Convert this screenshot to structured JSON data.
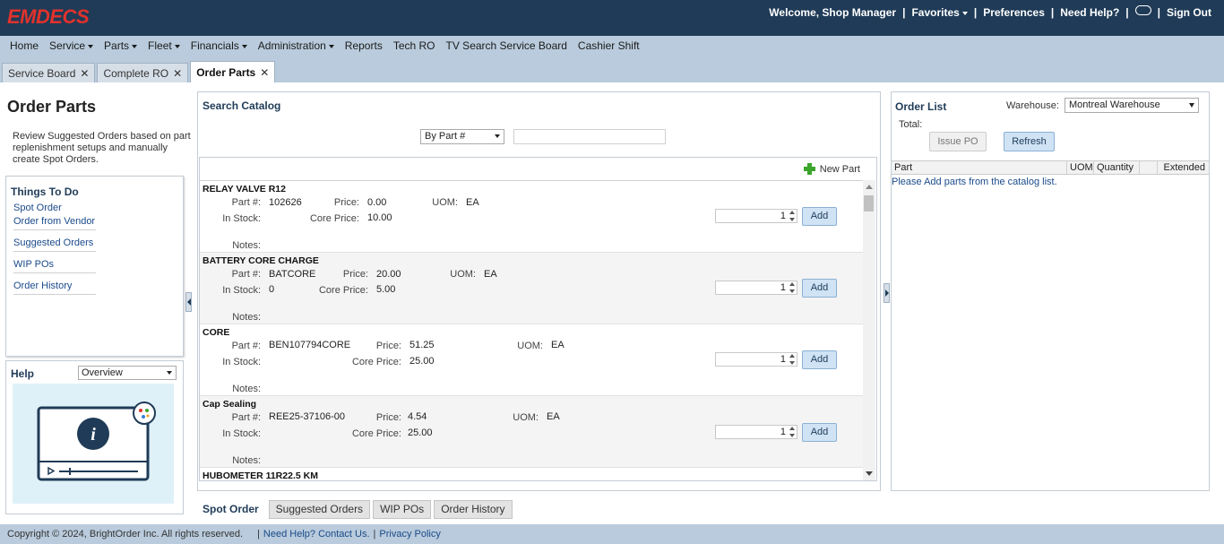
{
  "header": {
    "logo": "EMDECS",
    "welcome": "Welcome, Shop Manager",
    "favorites": "Favorites",
    "preferences": "Preferences",
    "need_help": "Need Help?",
    "sign_out": "Sign Out"
  },
  "menu": [
    {
      "label": "Home",
      "dropdown": false
    },
    {
      "label": "Service",
      "dropdown": true
    },
    {
      "label": "Parts",
      "dropdown": true
    },
    {
      "label": "Fleet",
      "dropdown": true
    },
    {
      "label": "Financials",
      "dropdown": true
    },
    {
      "label": "Administration",
      "dropdown": true
    },
    {
      "label": "Reports",
      "dropdown": false
    },
    {
      "label": "Tech RO",
      "dropdown": false
    },
    {
      "label": "TV Search Service Board",
      "dropdown": false
    },
    {
      "label": "Cashier Shift",
      "dropdown": false
    }
  ],
  "tabs": [
    {
      "label": "Service Board",
      "active": false
    },
    {
      "label": "Complete RO",
      "active": false
    },
    {
      "label": "Order Parts",
      "active": true
    }
  ],
  "left": {
    "title": "Order Parts",
    "description": "Review Suggested Orders based on part replenishment setups and manually create Spot Orders.",
    "things_title": "Things To Do",
    "links": [
      "Spot Order",
      "Order from Vendor",
      "Suggested Orders",
      "WIP POs",
      "Order History"
    ],
    "help_title": "Help",
    "help_select": "Overview"
  },
  "catalog": {
    "title": "Search Catalog",
    "search_by": "By Part #",
    "search_value": "",
    "new_part": "New Part",
    "labels": {
      "part_no": "Part #:",
      "price": "Price:",
      "uom": "UOM:",
      "in_stock": "In Stock:",
      "core_price": "Core Price:",
      "notes": "Notes:",
      "add": "Add"
    },
    "parts": [
      {
        "name": "RELAY VALVE R12",
        "part_no": "102626",
        "price": "0.00",
        "uom": "EA",
        "in_stock": "",
        "core_price": "10.00",
        "qty": "1"
      },
      {
        "name": "BATTERY CORE CHARGE",
        "part_no": "BATCORE",
        "price": "20.00",
        "uom": "EA",
        "in_stock": "0",
        "core_price": "5.00",
        "qty": "1"
      },
      {
        "name": "CORE",
        "part_no": "BEN107794CORE",
        "price": "51.25",
        "uom": "EA",
        "in_stock": "",
        "core_price": "25.00",
        "qty": "1"
      },
      {
        "name": "Cap Sealing",
        "part_no": "REE25-37106-00",
        "price": "4.54",
        "uom": "EA",
        "in_stock": "",
        "core_price": "25.00",
        "qty": "1"
      },
      {
        "name": "HUBOMETER 11R22.5 KM"
      }
    ]
  },
  "bottom_tabs": [
    {
      "label": "Spot Order",
      "active": true
    },
    {
      "label": "Suggested Orders",
      "active": false
    },
    {
      "label": "WIP POs",
      "active": false
    },
    {
      "label": "Order History",
      "active": false
    }
  ],
  "order_list": {
    "title": "Order List",
    "warehouse_label": "Warehouse:",
    "warehouse": "Montreal Warehouse",
    "total_label": "Total:",
    "issue_po": "Issue PO",
    "refresh": "Refresh",
    "columns": [
      "Part",
      "UOM",
      "Quantity",
      "",
      "Extended"
    ],
    "empty": "Please Add parts from the catalog list."
  },
  "footer": {
    "copyright": "Copyright © 2024, BrightOrder Inc. All rights reserved.",
    "help": "Need Help? Contact Us.",
    "privacy": "Privacy Policy"
  }
}
